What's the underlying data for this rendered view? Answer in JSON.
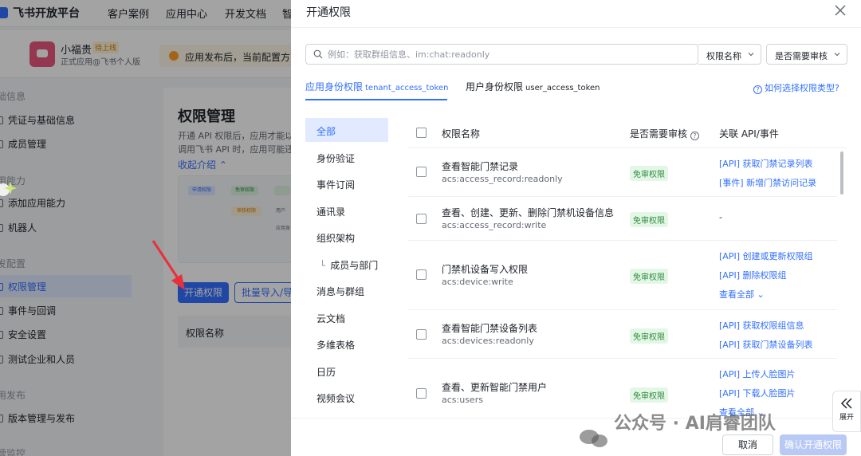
{
  "topnav": {
    "logo_text": "飞书开放平台",
    "items": [
      "客户案例",
      "应用中心",
      "开发文档",
      "智"
    ]
  },
  "appbar": {
    "app_name": "小福贵",
    "app_badge": "待上线",
    "app_sub": "正式应用@飞书个人版",
    "notice": "应用发布后，当前配置方可"
  },
  "sidebar": {
    "sections": [
      "础信息",
      "用能力",
      "发配置",
      "用发布",
      "营监控"
    ],
    "items": [
      "凭证与基础信息",
      "成员管理",
      "添加应用能力",
      "机器人",
      "权限管理",
      "事件与回调",
      "安全设置",
      "测试企业和人员",
      "版本管理与发布"
    ]
  },
  "content": {
    "title": "权限管理",
    "desc1": "开通 API 权限后，应用才能以",
    "desc2": "调用飞书 API 时，应用可能还",
    "collapse": "收起介绍",
    "diagram_labels": [
      "申请权限",
      "免审权限",
      "审核权限",
      "用户",
      "应用身"
    ],
    "btn_primary": "开通权限",
    "btn_outline": "批量导入/导",
    "table_head": "权限名称"
  },
  "modal": {
    "title": "开通权限",
    "search_placeholder": "例如：获取群组信息、im:chat:readonly",
    "select_field": "权限名称",
    "select_review": "是否需要审核",
    "tabs": [
      {
        "label": "应用身份权限",
        "sub": "tenant_access_token"
      },
      {
        "label": "用户身份权限",
        "sub": "user_access_token"
      }
    ],
    "help_link": "如何选择权限类型?",
    "categories": [
      "全部",
      "身份验证",
      "事件订阅",
      "通讯录",
      "组织架构",
      "成员与部门",
      "消息与群组",
      "云文档",
      "多维表格",
      "日历",
      "视频会议"
    ],
    "columns": [
      "权限名称",
      "是否需要审核",
      "关联 API/事件"
    ],
    "rows": [
      {
        "name": "查看智能门禁记录",
        "code": "acs:access_record:readonly",
        "badge": "免审权限",
        "links": [
          "[API] 获取门禁记录列表",
          "[事件] 新增门禁访问记录"
        ]
      },
      {
        "name": "查看、创建、更新、删除门禁机设备信息",
        "code": "acs:access_record:write",
        "badge": "免审权限",
        "dash": "-"
      },
      {
        "name": "门禁机设备写入权限",
        "code": "acs:device:write",
        "badge": "免审权限",
        "links": [
          "[API] 创建或更新权限组",
          "[API] 删除权限组"
        ],
        "more": "查看全部"
      },
      {
        "name": "查看智能门禁设备列表",
        "code": "acs:devices:readonly",
        "badge": "免审权限",
        "links": [
          "[API] 获取权限组信息",
          "[API] 获取门禁设备列表"
        ]
      },
      {
        "name": "查看、更新智能门禁用户",
        "code": "acs:users",
        "badge": "免审权限",
        "links": [
          "[API] 上传人脸图片",
          "[API] 下载人脸图片"
        ],
        "more": "查看全部"
      }
    ],
    "cancel": "取消",
    "confirm": "确认开通权限"
  },
  "watermark": "公众号 · AI肩睿团队",
  "expand_label": "展开",
  "colors": {
    "accent": "#3370ff",
    "badge_bg": "#e4f7e6",
    "badge_text": "#2c8a3e",
    "arrow": "#e8303a"
  }
}
